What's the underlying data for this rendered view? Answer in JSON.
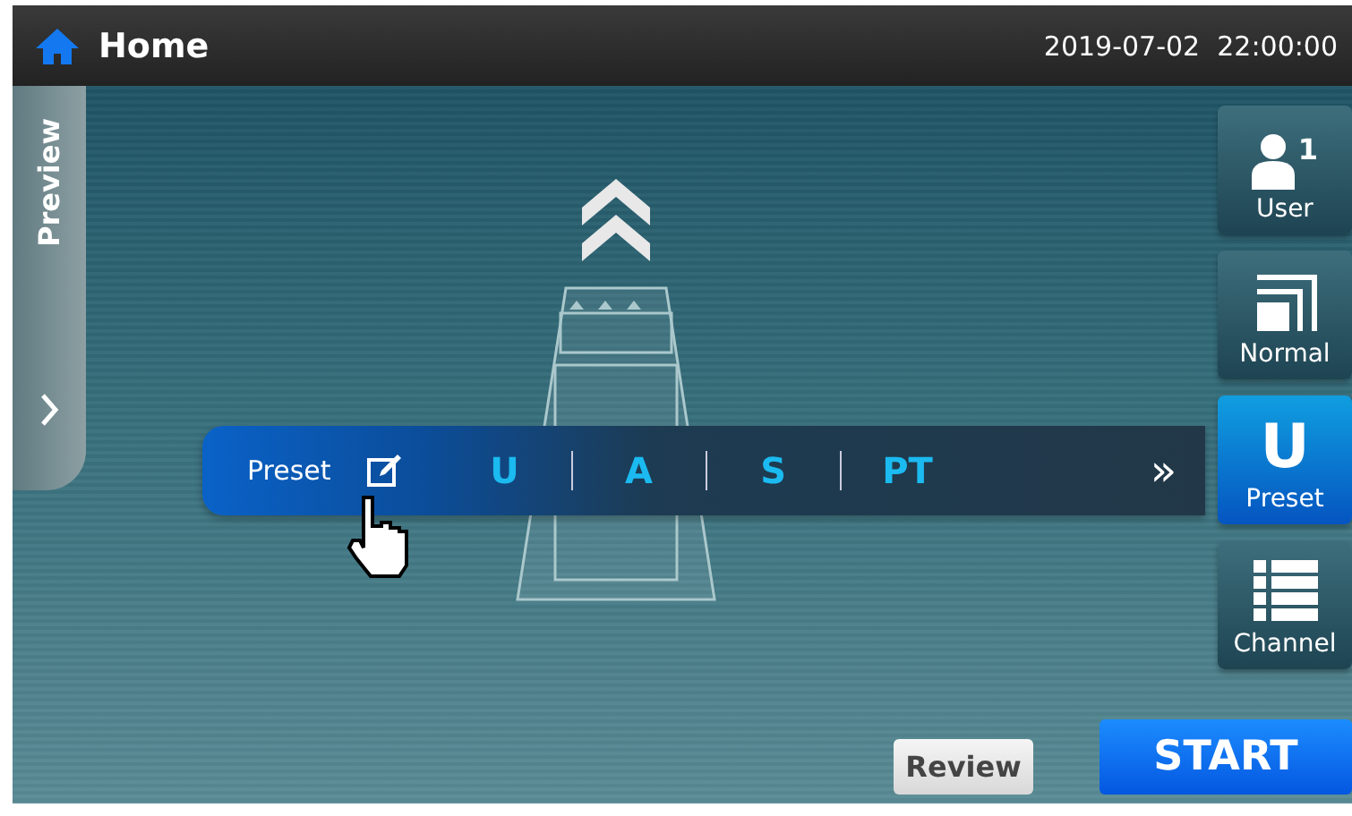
{
  "header": {
    "title": "Home",
    "datetime": "2019-07-02  22:00:00"
  },
  "preview_tab": {
    "label": "Preview"
  },
  "preset_bar": {
    "label": "Preset",
    "options": [
      {
        "label": "U"
      },
      {
        "label": "A"
      },
      {
        "label": "S"
      },
      {
        "label": "PT"
      }
    ],
    "more": "»"
  },
  "side_buttons": [
    {
      "kind": "user",
      "label": "User",
      "badge": "1",
      "selected": false
    },
    {
      "kind": "normal",
      "label": "Normal",
      "selected": false
    },
    {
      "kind": "preset",
      "label": "Preset",
      "glyph": "U",
      "selected": true
    },
    {
      "kind": "channel",
      "label": "Channel",
      "selected": false
    }
  ],
  "actions": [
    {
      "kind": "secondary",
      "label": "Review"
    },
    {
      "kind": "primary",
      "label": "START"
    }
  ]
}
